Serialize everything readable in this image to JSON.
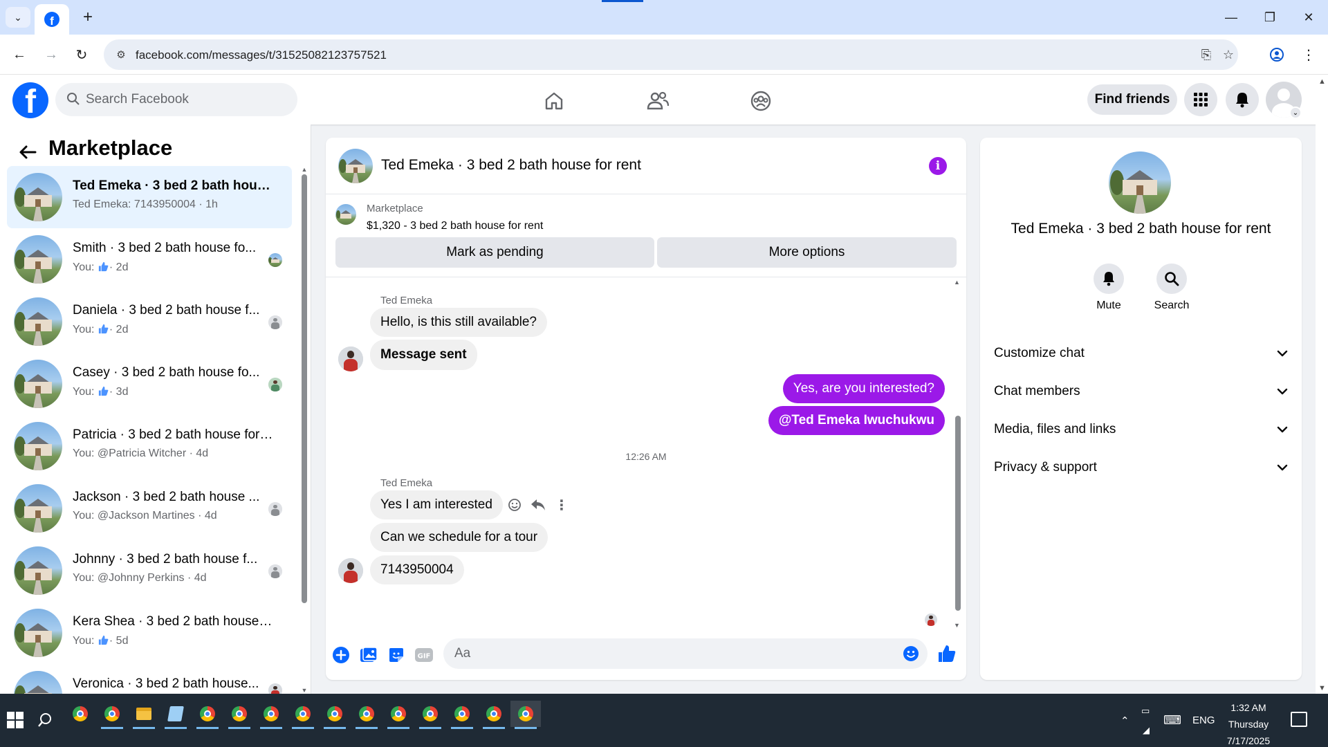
{
  "browser": {
    "url": "facebook.com/messages/t/31525082123757521"
  },
  "fb_header": {
    "search_placeholder": "Search Facebook",
    "find_friends": "Find friends"
  },
  "sidebar": {
    "title": "Marketplace",
    "conversations": [
      {
        "name": "Ted Emeka · 3 bed 2 bath house ...",
        "sub": "Ted Emeka: 7143950004 · 1h",
        "active": true
      },
      {
        "name": "Smith · 3 bed 2 bath house fo...",
        "sub_prefix": "You:",
        "sub_suffix": "· 2d"
      },
      {
        "name": "Daniela · 3 bed 2 bath house f...",
        "sub_prefix": "You:",
        "sub_suffix": "· 2d"
      },
      {
        "name": "Casey · 3 bed 2 bath house fo...",
        "sub_prefix": "You:",
        "sub_suffix": "· 3d"
      },
      {
        "name": "Patricia · 3 bed 2 bath house for ...",
        "sub": "You: @Patricia Witcher · 4d"
      },
      {
        "name": "Jackson · 3 bed 2 bath house ...",
        "sub": "You: @Jackson Martines · 4d"
      },
      {
        "name": "Johnny · 3 bed 2 bath house f...",
        "sub": "You: @Johnny Perkins · 4d"
      },
      {
        "name": "Kera Shea · 3 bed 2 bath house f...",
        "sub_prefix": "You:",
        "sub_suffix": "· 5d"
      },
      {
        "name": "Veronica · 3 bed 2 bath house..."
      }
    ]
  },
  "chat": {
    "title": "Ted Emeka · 3 bed 2 bath house for rent",
    "listing_source": "Marketplace",
    "listing_desc": "$1,320 - 3 bed 2 bath house for rent",
    "mark_pending": "Mark as pending",
    "more_options": "More options",
    "sender_1": "Ted Emeka",
    "msg_1": "Hello, is this still available?",
    "msg_2": "Message sent",
    "out_1": "Yes, are you interested?",
    "out_2": "@Ted Emeka Iwuchukwu",
    "timestamp": "12:26 AM",
    "sender_2": "Ted Emeka",
    "msg_3": "Yes I am interested",
    "msg_4": "Can we schedule for a tour",
    "msg_5": "7143950004",
    "composer_placeholder": "Aa",
    "accent": "#9b19e8"
  },
  "info_panel": {
    "name": "Ted Emeka · 3 bed 2 bath house for rent",
    "mute": "Mute",
    "search": "Search",
    "sections": [
      "Customize chat",
      "Chat members",
      "Media, files and links",
      "Privacy & support"
    ]
  },
  "taskbar": {
    "lang": "ENG",
    "time": "1:32 AM",
    "day": "Thursday",
    "date": "7/17/2025"
  },
  "colors": {
    "fb_blue": "#0866ff",
    "messenger_purple": "#9b19e8",
    "active_row": "#e7f3ff"
  }
}
